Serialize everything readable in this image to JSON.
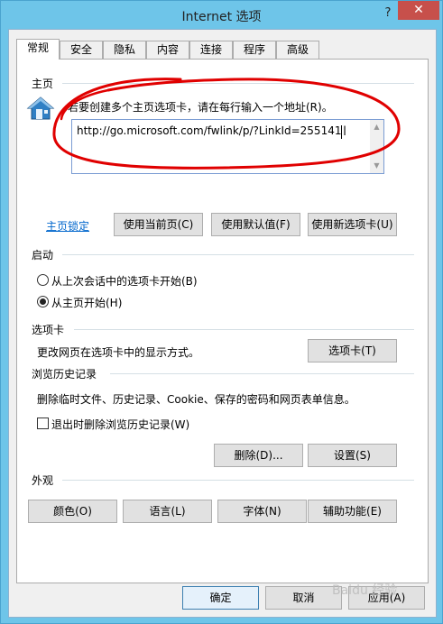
{
  "window": {
    "title": "Internet 选项",
    "help": "?",
    "close": "✕"
  },
  "tabs": [
    {
      "label": "常规"
    },
    {
      "label": "安全"
    },
    {
      "label": "隐私"
    },
    {
      "label": "内容"
    },
    {
      "label": "连接"
    },
    {
      "label": "程序"
    },
    {
      "label": "高级"
    }
  ],
  "home": {
    "title": "主页",
    "description": "若要创建多个主页选项卡，请在每行输入一个地址(R)。",
    "url": "http://go.microsoft.com/fwlink/p/?LinkId=255141",
    "lock_link": "主页锁定",
    "buttons": {
      "use_current": "使用当前页(C)",
      "use_default": "使用默认值(F)",
      "use_new_tab": "使用新选项卡(U)"
    }
  },
  "startup": {
    "title": "启动",
    "options": [
      {
        "label": "从上次会话中的选项卡开始(B)",
        "selected": false
      },
      {
        "label": "从主页开始(H)",
        "selected": true
      }
    ]
  },
  "tabs_group": {
    "title": "选项卡",
    "description": "更改网页在选项卡中的显示方式。",
    "button": "选项卡(T)"
  },
  "history": {
    "title": "浏览历史记录",
    "description": "删除临时文件、历史记录、Cookie、保存的密码和网页表单信息。",
    "checkbox": "退出时删除浏览历史记录(W)",
    "checked": false,
    "delete_button": "删除(D)...",
    "settings_button": "设置(S)"
  },
  "appearance": {
    "title": "外观",
    "buttons": {
      "colors": "颜色(O)",
      "languages": "语言(L)",
      "fonts": "字体(N)",
      "accessibility": "辅助功能(E)"
    }
  },
  "footer": {
    "ok": "确定",
    "cancel": "取消",
    "apply": "应用(A)"
  },
  "icons": {
    "home": "home-icon",
    "ibeam": "text-cursor-icon"
  },
  "colors": {
    "accent": "#6ec5e9",
    "close": "#c7504b",
    "link": "#0066cc",
    "annotation": "#e00000"
  },
  "watermark": "Baidu 经验"
}
